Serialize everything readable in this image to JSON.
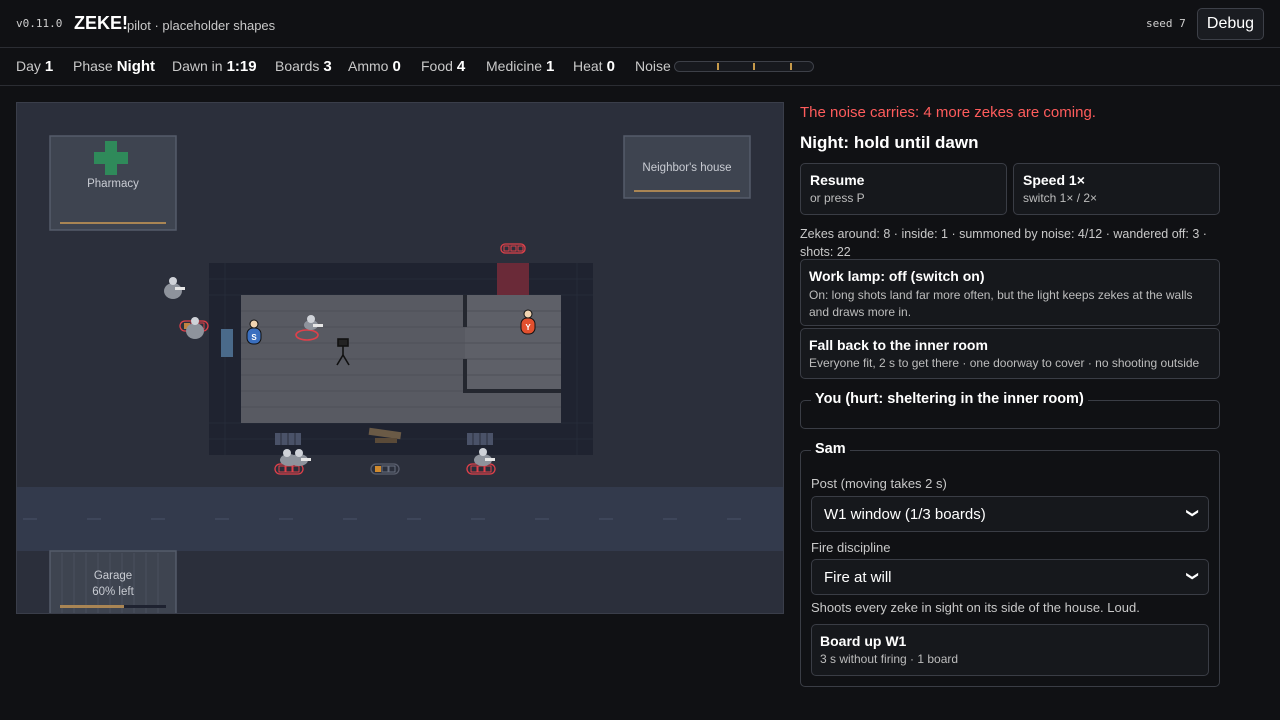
{
  "header": {
    "version": "v0.11.0",
    "title": "ZEKE!",
    "subtitle": "pilot · placeholder shapes",
    "seed": "seed 7",
    "debug_label": "Debug"
  },
  "stats": {
    "day_label": "Day",
    "day": "1",
    "phase_label": "Phase",
    "phase": "Night",
    "dawn_label": "Dawn in",
    "dawn": "1:19",
    "boards_label": "Boards",
    "boards": "3",
    "ammo_label": "Ammo",
    "ammo": "0",
    "food_label": "Food",
    "food": "4",
    "medicine_label": "Medicine",
    "medicine": "1",
    "heat_label": "Heat",
    "heat": "0",
    "noise_label": "Noise"
  },
  "map": {
    "pharmacy_label": "Pharmacy",
    "neighbor_label": "Neighbor's house",
    "garage_label": "Garage",
    "garage_left": "60% left",
    "garage_fraction_left": 0.6,
    "sam_marker": "S",
    "you_marker": "Y",
    "colors": {
      "ground": "#2b2f3b",
      "floor": "#585a62",
      "street": "#333a4c",
      "danger": "#e0404a",
      "pharmacy_cross": "#2f8a5a"
    }
  },
  "panel": {
    "alert": "The noise carries: 4 more zekes are coming.",
    "night_title": "Night: hold until dawn",
    "resume": {
      "title": "Resume",
      "sub": "or press P"
    },
    "speed": {
      "title": "Speed 1×",
      "sub": "switch 1× / 2×"
    },
    "info": "Zekes around: 8 · inside: 1 · summoned by noise: 4/12 · wandered off: 3 · shots: 22",
    "lamp": {
      "title": "Work lamp: off (switch on)",
      "sub": "On: long shots land far more often, but the light keeps zekes at the walls and draws more in."
    },
    "fallback": {
      "title": "Fall back to the inner room",
      "sub": "Everyone fit, 2 s to get there · one doorway to cover · no shooting outside"
    },
    "you_legend": "You (hurt: sheltering in the inner room)",
    "sam": {
      "legend": "Sam",
      "post_label": "Post (moving takes 2 s)",
      "post_value": "W1 window (1/3 boards)",
      "fire_label": "Fire discipline",
      "fire_value": "Fire at will",
      "fire_desc": "Shoots every zeke in sight on its side of the house. Loud.",
      "board_title": "Board up W1",
      "board_sub": "3 s without firing · 1 board"
    }
  }
}
